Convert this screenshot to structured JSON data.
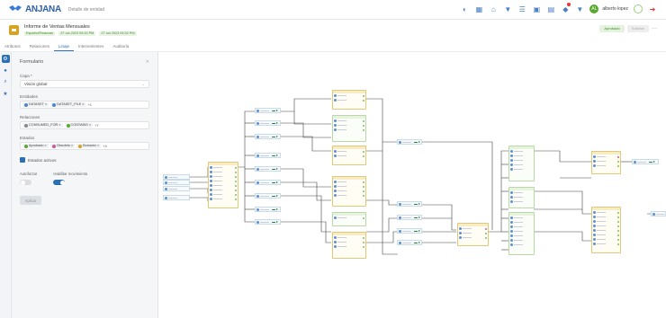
{
  "app": {
    "logo_text": "ANJANA",
    "page_title": "Detalle de entidad"
  },
  "user": {
    "name": "alberto lopez",
    "initials": "AL"
  },
  "colors": {
    "accent": "#2d6fb4",
    "approved": "#3a8a25",
    "entity": "#d9a320"
  },
  "entity": {
    "title": "Informe de Ventas Mensuales",
    "tags": [
      "Español/Finanzas",
      "27 oct 2023 09:32 PM",
      "27 oct 2023 09:32 PM"
    ],
    "actions": {
      "approved": "Aprobado",
      "secondary": "Solicitar",
      "more": "···"
    }
  },
  "tabs": [
    "Atributos",
    "Relaciones",
    "Linaje",
    "Intervenientes",
    "Auditoría"
  ],
  "rail": {
    "icons": [
      "settings-icon",
      "circle-icon",
      "search-icon",
      "star-icon"
    ]
  },
  "panel": {
    "title": "Formulario",
    "close": "✕",
    "type_label": "Capa *",
    "type_value": "Visión global",
    "entities_label": "Entidades",
    "entities_chips": [
      "DATASET",
      "DATASET_FILE"
    ],
    "entities_more": "+1",
    "relations_label": "Relaciones",
    "relations_chips": [
      "CONSUMED_FOR",
      "CONTAINS"
    ],
    "relations_more": "+7",
    "states_label": "Estados",
    "states_chips": [
      "Aprobado",
      "Obsoleto",
      "Borrador"
    ],
    "states_more": "+4",
    "active_label": "Estados activos",
    "toggle1_label": "Autoforzar",
    "toggle2_label": "Habilitar movimiento",
    "apply_label": "Aplicar"
  }
}
